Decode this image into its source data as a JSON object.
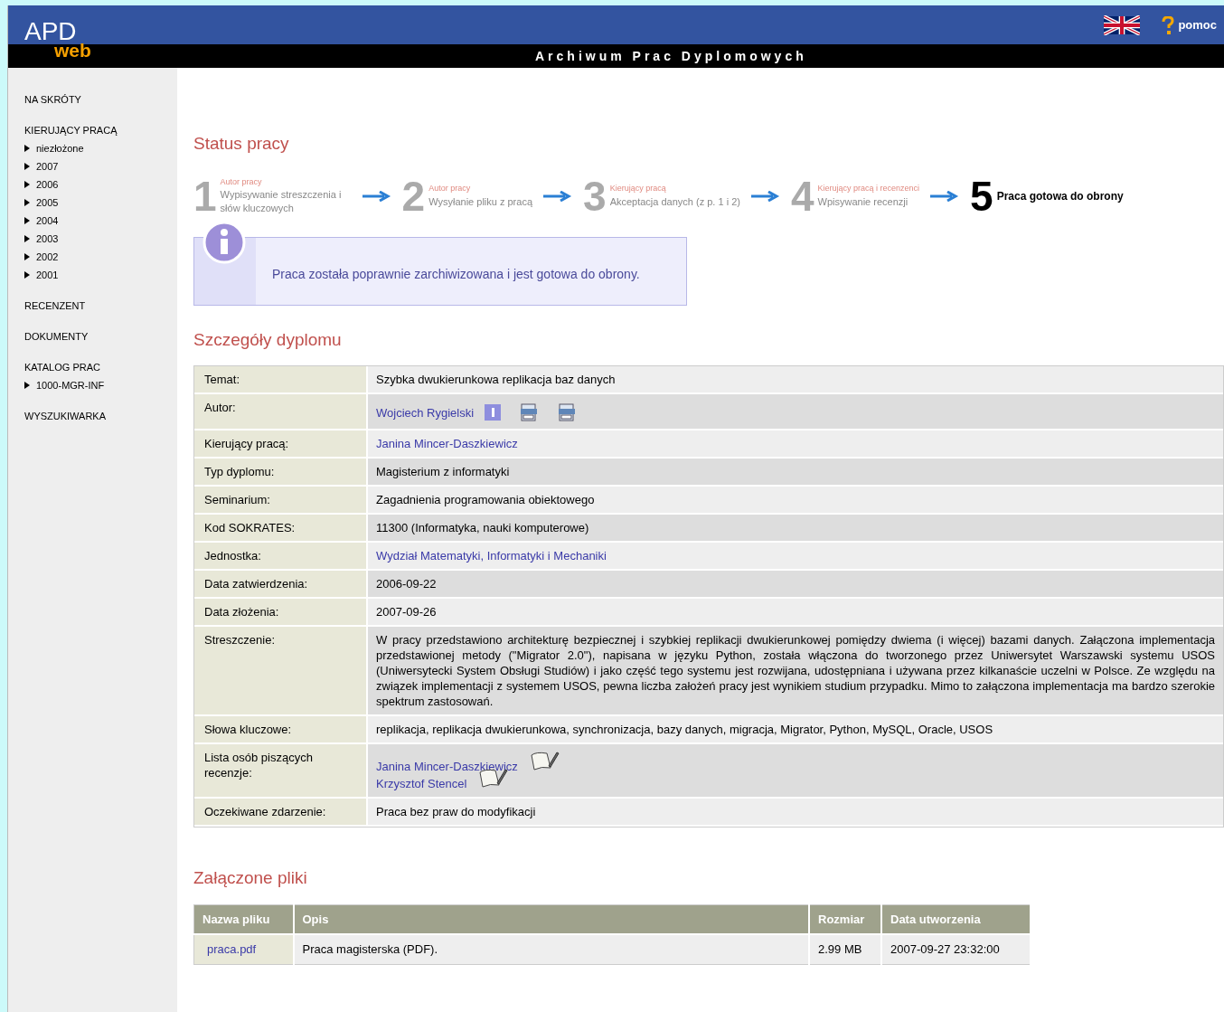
{
  "header": {
    "logo_main": "APD",
    "logo_sub": "web",
    "subtitle": "Archiwum Prac Dyplomowych",
    "help": "pomoc"
  },
  "sidebar": {
    "sections": [
      {
        "label": "NA SKRÓTY"
      },
      {
        "label": "KIERUJĄCY PRACĄ",
        "children": [
          "niezłożone",
          "2007",
          "2006",
          "2005",
          "2004",
          "2003",
          "2002",
          "2001"
        ]
      },
      {
        "label": "RECENZENT"
      },
      {
        "label": "DOKUMENTY"
      },
      {
        "label": "KATALOG PRAC",
        "children": [
          "1000-MGR-INF"
        ]
      },
      {
        "label": "WYSZUKIWARKA"
      }
    ]
  },
  "status": {
    "title": "Status pracy",
    "steps": [
      {
        "number": "1",
        "role": "Autor pracy",
        "text": "Wypisywanie streszczenia i słów kluczowych",
        "current": false
      },
      {
        "number": "2",
        "role": "Autor pracy",
        "text": "Wysyłanie pliku z pracą",
        "current": false
      },
      {
        "number": "3",
        "role": "Kierujący pracą",
        "text": "Akceptacja danych (z p. 1 i 2)",
        "current": false
      },
      {
        "number": "4",
        "role": "Kierujący pracą i recenzenci",
        "text": "Wpisywanie recenzji",
        "current": false
      },
      {
        "number": "5",
        "text": "Praca gotowa do obrony",
        "current": true
      }
    ],
    "info": "Praca została poprawnie zarchiwizowana i jest gotowa do obrony."
  },
  "details": {
    "title": "Szczegóły dyplomu",
    "rows": [
      {
        "label": "Temat:",
        "kind": "text",
        "value": "Szybka dwukierunkowa replikacja baz danych"
      },
      {
        "label": "Autor:",
        "kind": "author",
        "value": "Wojciech Rygielski"
      },
      {
        "label": "Kierujący pracą:",
        "kind": "link",
        "value": "Janina Mincer-Daszkiewicz"
      },
      {
        "label": "Typ dyplomu:",
        "kind": "text",
        "value": "Magisterium z informatyki"
      },
      {
        "label": "Seminarium:",
        "kind": "text",
        "value": "Zagadnienia programowania obiektowego"
      },
      {
        "label": "Kod SOKRATES:",
        "kind": "text",
        "value": "11300 (Informatyka, nauki komputerowe)"
      },
      {
        "label": "Jednostka:",
        "kind": "link",
        "value": "Wydział Matematyki, Informatyki i Mechaniki"
      },
      {
        "label": "Data zatwierdzenia:",
        "kind": "text",
        "value": "2006-09-22"
      },
      {
        "label": "Data złożenia:",
        "kind": "text",
        "value": "2007-09-26"
      },
      {
        "label": "Streszczenie:",
        "kind": "text",
        "value": "W pracy przedstawiono architekturę bezpiecznej i szybkiej replikacji dwukierunkowej pomiędzy dwiema (i więcej) bazami danych. Załączona implementacja przedstawionej metody (\"Migrator 2.0\"), napisana w języku Python, została włączona do tworzonego przez Uniwersytet Warszawski systemu USOS (Uniwersytecki System Obsługi Studiów) i jako część tego systemu jest rozwijana, udostępniana i używana przez kilkanaście uczelni w Polsce. Ze względu na związek implementacji z systemem USOS, pewna liczba założeń pracy jest wynikiem studium przypadku. Mimo to załączona implementacja ma bardzo szerokie spektrum zastosowań."
      },
      {
        "label": "Słowa kluczowe:",
        "kind": "text",
        "value": "replikacja, replikacja dwukierunkowa, synchronizacja, bazy danych, migracja, Migrator, Python, MySQL, Oracle, USOS"
      },
      {
        "label": "Lista osób piszących recenzje:",
        "kind": "reviewers",
        "values": [
          "Janina Mincer-Daszkiewicz",
          "Krzysztof Stencel"
        ]
      },
      {
        "label": "Oczekiwane zdarzenie:",
        "kind": "text",
        "value": "Praca bez praw do modyfikacji"
      }
    ]
  },
  "files": {
    "title": "Załączone pliki",
    "columns": [
      "Nazwa pliku",
      "Opis",
      "Rozmiar",
      "Data utworzenia"
    ],
    "rows": [
      [
        "praca.pdf",
        "Praca magisterska (PDF).",
        "2.99 MB",
        "2007-09-27 23:32:00"
      ]
    ]
  }
}
